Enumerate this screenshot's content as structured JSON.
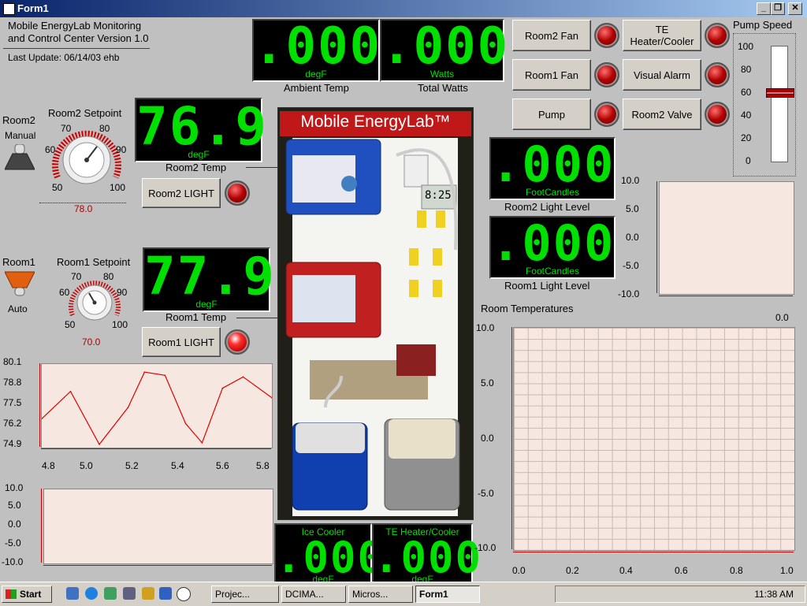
{
  "window": {
    "title": "Form1",
    "minimize": "_",
    "maximize": "❐",
    "close": "✕"
  },
  "header": {
    "line1": "Mobile EnergyLab Monitoring",
    "line2": "and Control Center Version 1.0",
    "last_update": "Last Update: 06/14/03 ehb"
  },
  "displays": {
    "ambient": {
      "value": ".000",
      "unit": "degF",
      "label": "Ambient Temp"
    },
    "watts": {
      "value": ".000",
      "unit": "Watts",
      "label": "Total Watts"
    },
    "room2_temp": {
      "value": "76.9",
      "unit": "degF",
      "label": "Room2 Temp"
    },
    "room1_temp": {
      "value": "77.9",
      "unit": "degF",
      "label": "Room1 Temp"
    },
    "room2_light": {
      "value": ".000",
      "unit": "FootCandles",
      "label": "Room2 Light Level"
    },
    "room1_light": {
      "value": ".000",
      "unit": "FootCandles",
      "label": "Room1 Light Level"
    },
    "ice_cooler": {
      "header": "Ice Cooler",
      "value": ".000",
      "unit": "degF"
    },
    "te_cooler": {
      "header": "TE Heater/Cooler",
      "value": ".000",
      "unit": "degF"
    }
  },
  "room2": {
    "name": "Room2",
    "mode": "Manual",
    "setpoint_label": "Room2 Setpoint",
    "setpoint_value": "78.0",
    "light_button": "Room2 LIGHT",
    "knob_ticks": [
      "50",
      "60",
      "70",
      "80",
      "90",
      "100"
    ]
  },
  "room1": {
    "name": "Room1",
    "mode": "Auto",
    "setpoint_label": "Room1 Setpoint",
    "setpoint_value": "70.0",
    "light_button": "Room1 LIGHT",
    "knob_ticks": [
      "50",
      "60",
      "70",
      "80",
      "90",
      "100"
    ]
  },
  "controls": {
    "room2_fan": "Room2 Fan",
    "room1_fan": "Room1 Fan",
    "pump": "Pump",
    "te_heater_line1": "TE",
    "te_heater_line2": "Heater/Cooler",
    "visual_alarm": "Visual Alarm",
    "room2_valve": "Room2 Valve"
  },
  "pump_speed": {
    "label": "Pump Speed",
    "ticks": [
      "100",
      "80",
      "60",
      "40",
      "20",
      "0"
    ],
    "value": 60
  },
  "photo": {
    "banner": "Mobile EnergyLab™",
    "clock": "8:25"
  },
  "plots": {
    "small_right": {
      "yticks": [
        "10.0",
        "5.0",
        "0.0",
        "-5.0",
        "-10.0"
      ],
      "xval": "0.0"
    },
    "room_temps": {
      "title": "Room Temperatures",
      "yticks": [
        "10.0",
        "5.0",
        "0.0",
        "-5.0",
        "-10.0"
      ],
      "xticks": [
        "0.0",
        "0.2",
        "0.4",
        "0.6",
        "0.8",
        "1.0"
      ]
    },
    "left_bottom": {
      "yticks": [
        "10.0",
        "5.0",
        "0.0",
        "-5.0",
        "-10.0"
      ]
    }
  },
  "chart_data": {
    "type": "line",
    "title": "",
    "x": [
      4.72,
      4.86,
      5.0,
      5.14,
      5.22,
      5.32,
      5.42,
      5.5,
      5.6,
      5.7,
      5.84
    ],
    "values": [
      76.7,
      78.4,
      75.1,
      77.4,
      79.6,
      79.4,
      76.4,
      75.2,
      78.6,
      79.3,
      78.0
    ],
    "ylim": [
      74.9,
      80.1
    ],
    "xlim": [
      4.72,
      5.84
    ],
    "yticks": [
      "80.1",
      "78.8",
      "77.5",
      "76.2",
      "74.9"
    ],
    "xticks": [
      "4.8",
      "5.0",
      "5.2",
      "5.4",
      "5.6",
      "5.8"
    ],
    "line_color": "#e00000"
  },
  "taskbar": {
    "start": "Start",
    "items": [
      "Projec...",
      "DCIMA...",
      "Micros...",
      "Form1"
    ],
    "clock": "11:38 AM"
  }
}
